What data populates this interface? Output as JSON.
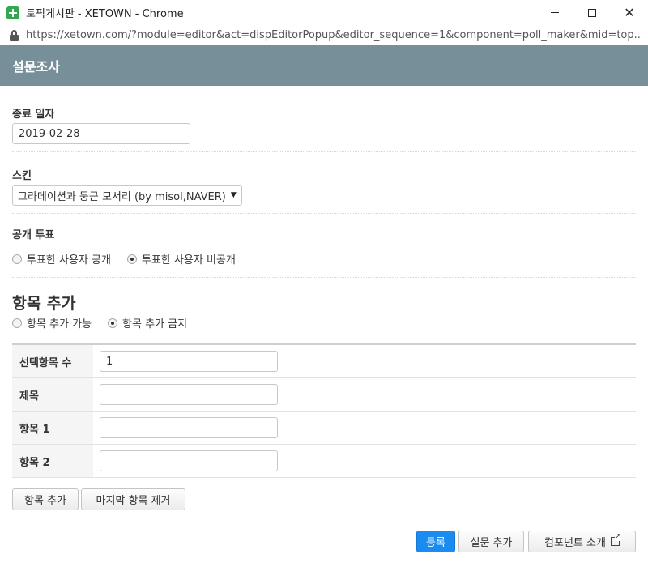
{
  "window": {
    "title": "토픽게시판 - XETOWN - Chrome",
    "url": "https://xetown.com/?module=editor&act=dispEditorPopup&editor_sequence=1&component=poll_maker&mid=top..."
  },
  "header": {
    "title": "설문조사"
  },
  "form": {
    "end_date": {
      "label": "종료 일자",
      "value": "2019-02-28"
    },
    "skin": {
      "label": "스킨",
      "selected": "그라데이션과 둥근 모서리 (by misol,NAVER)"
    },
    "public_vote": {
      "label": "공개 투표",
      "options": [
        {
          "label": "투표한 사용자 공개",
          "checked": false
        },
        {
          "label": "투표한 사용자 비공개",
          "checked": true
        }
      ]
    },
    "add_items": {
      "label": "항목 추가",
      "options": [
        {
          "label": "항목 추가 가능",
          "checked": false
        },
        {
          "label": "항목 추가 금지",
          "checked": true
        }
      ]
    },
    "rows": [
      {
        "label": "선택항목 수",
        "value": "1"
      },
      {
        "label": "제목",
        "value": ""
      },
      {
        "label": "항목 1",
        "value": ""
      },
      {
        "label": "항목 2",
        "value": ""
      }
    ]
  },
  "buttons": {
    "add_item": "항목 추가",
    "remove_last": "마지막 항목 제거",
    "submit": "등록",
    "add_poll": "설문 추가",
    "component_info": "컴포넌트 소개"
  },
  "colors": {
    "header_bg": "#778f99",
    "primary": "#1a8cf0"
  }
}
